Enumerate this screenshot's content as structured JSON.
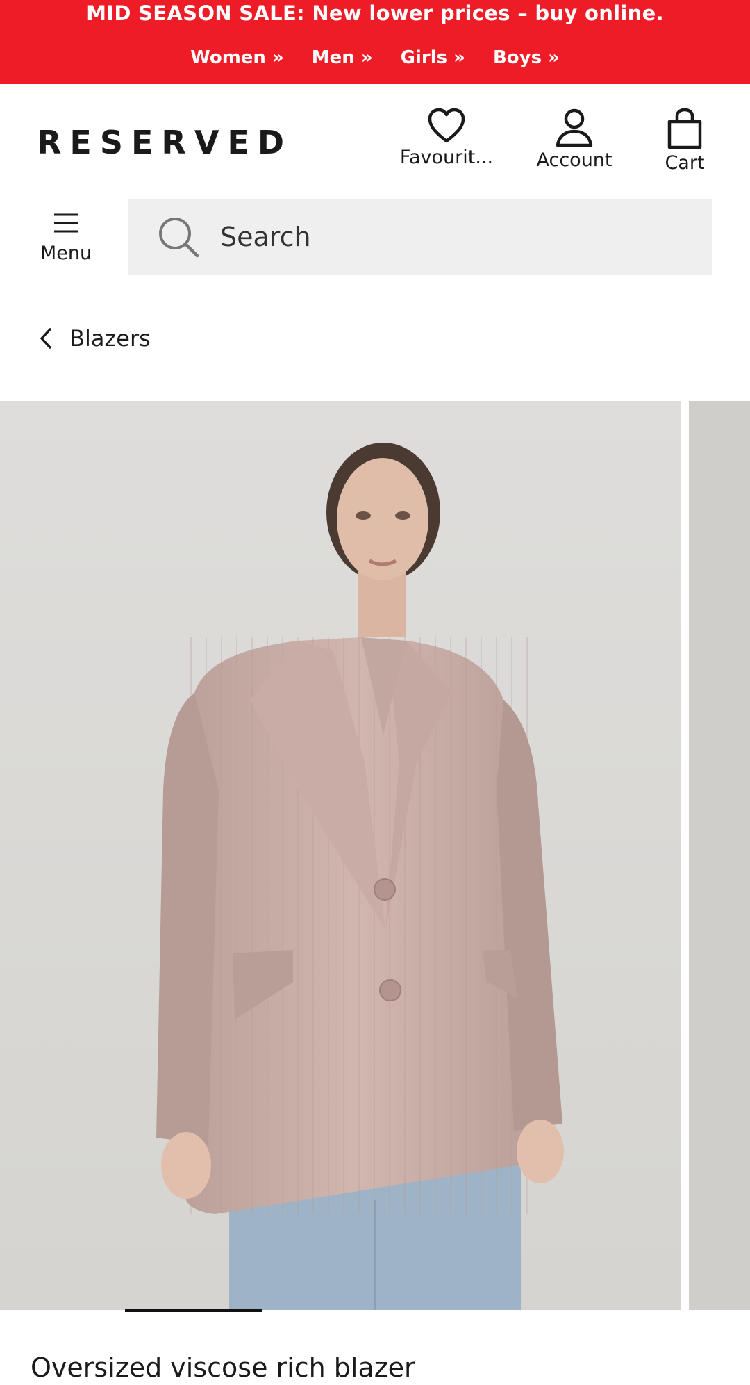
{
  "promo": {
    "title": "MID SEASON SALE: New lower prices – buy online.",
    "links": [
      "Women »",
      "Men »",
      "Girls »",
      "Boys »"
    ],
    "background": "#ee1c27"
  },
  "header": {
    "logo": "RESERVED",
    "favourites_label": "Favourit...",
    "account_label": "Account",
    "cart_label": "Cart"
  },
  "menu": {
    "label": "Menu"
  },
  "search": {
    "placeholder": "Search"
  },
  "breadcrumb": {
    "back_label": "Blazers"
  },
  "product": {
    "title": "Oversized viscose rich blazer"
  }
}
